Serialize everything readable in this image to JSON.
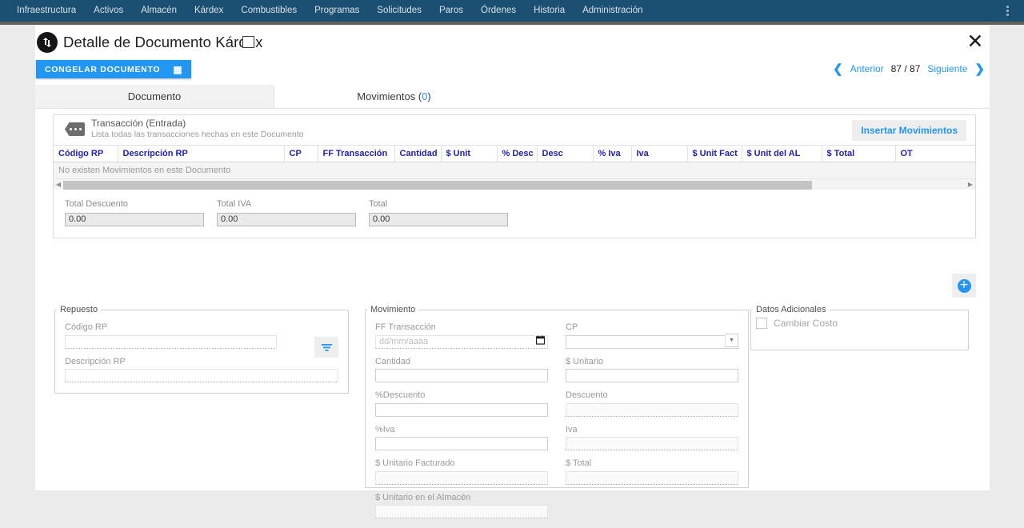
{
  "navbar": {
    "items": [
      {
        "label": "Infraestructura"
      },
      {
        "label": "Activos"
      },
      {
        "label": "Almacén"
      },
      {
        "label": "Kárdex"
      },
      {
        "label": "Combustibles"
      },
      {
        "label": "Programas"
      },
      {
        "label": "Solicitudes"
      },
      {
        "label": "Paros"
      },
      {
        "label": "Órdenes"
      },
      {
        "label": "Historia"
      },
      {
        "label": "Administración"
      }
    ],
    "menu_icon": "kebab-menu-icon",
    "background": "#1b4f72"
  },
  "header": {
    "icon": "transfer-arrows-icon",
    "title": "Detalle de Documento Kárdex",
    "checkbox_checked": false,
    "close_icon": "close-icon",
    "freeze_button": {
      "label": "CONGELAR DOCUMENTO",
      "icon": "freeze-grid-icon",
      "color": "#2196f3"
    },
    "pager": {
      "prev_label": "Anterior",
      "next_label": "Siguiente",
      "counter": "87 / 87",
      "prev_icon": "chevron-left-icon",
      "next_icon": "chevron-right-icon",
      "link_color": "#2196f3"
    }
  },
  "tabs": [
    {
      "label": "Documento",
      "active": false
    },
    {
      "label": "Movimientos (",
      "count": "0",
      "suffix": ")",
      "active": true
    }
  ],
  "transaction_card": {
    "icon": "tag-dots-icon",
    "title": "Transacción (Entrada)",
    "subtitle": "Lista todas las transacciones hechas en este Documento",
    "insert_button": "Insertar Movimientos",
    "table": {
      "columns": [
        "Código RP",
        "Descripción RP",
        "CP",
        "FF Transacción",
        "Cantidad",
        "$ Unit",
        "% Desc",
        "Desc",
        "% Iva",
        "Iva",
        "$ Unit Fact",
        "$ Unit del AL",
        "$ Total",
        "OT"
      ],
      "rows": [],
      "empty_message": "No existen Movimientos en este Documento",
      "header_color": "#2222aa"
    },
    "scrollbar": {
      "left_arrow": "scroll-left-icon",
      "right_arrow": "scroll-right-icon"
    },
    "totals": [
      {
        "label": "Total Descuento",
        "value": "0.00"
      },
      {
        "label": "Total IVA",
        "value": "0.00"
      },
      {
        "label": "Total",
        "value": "0.00"
      }
    ]
  },
  "add_button": {
    "icon": "add-circle-icon",
    "color": "#2196f3"
  },
  "repuesto": {
    "legend": "Repuesto",
    "codigo_label": "Código RP",
    "codigo_value": "",
    "descripcion_label": "Descripción RP",
    "descripcion_value": "",
    "filter_icon": "filter-icon"
  },
  "movimiento": {
    "legend": "Movimiento",
    "fields": [
      {
        "label": "FF Transacción",
        "value": "",
        "placeholder": "dd/mm/aaaa",
        "type": "date"
      },
      {
        "label": "CP",
        "value": "",
        "type": "select"
      },
      {
        "label": "Cantidad",
        "value": "",
        "type": "text"
      },
      {
        "label": "$ Unitario",
        "value": "",
        "type": "text"
      },
      {
        "label": "%Descuento",
        "value": "",
        "type": "text"
      },
      {
        "label": "Descuento",
        "value": "",
        "type": "text-disabled"
      },
      {
        "label": "%Iva",
        "value": "",
        "type": "text"
      },
      {
        "label": "Iva",
        "value": "",
        "type": "text-disabled"
      },
      {
        "label": "$ Unitario Facturado",
        "value": "",
        "type": "text-disabled"
      },
      {
        "label": "$ Total",
        "value": "",
        "type": "text-disabled"
      },
      {
        "label": "$ Unitario en el Almacén",
        "value": "",
        "type": "text-disabled"
      }
    ]
  },
  "datos_adicionales": {
    "legend": "Datos Adicionales",
    "checkbox_label": "Cambiar Costo",
    "checkbox_checked": false
  }
}
